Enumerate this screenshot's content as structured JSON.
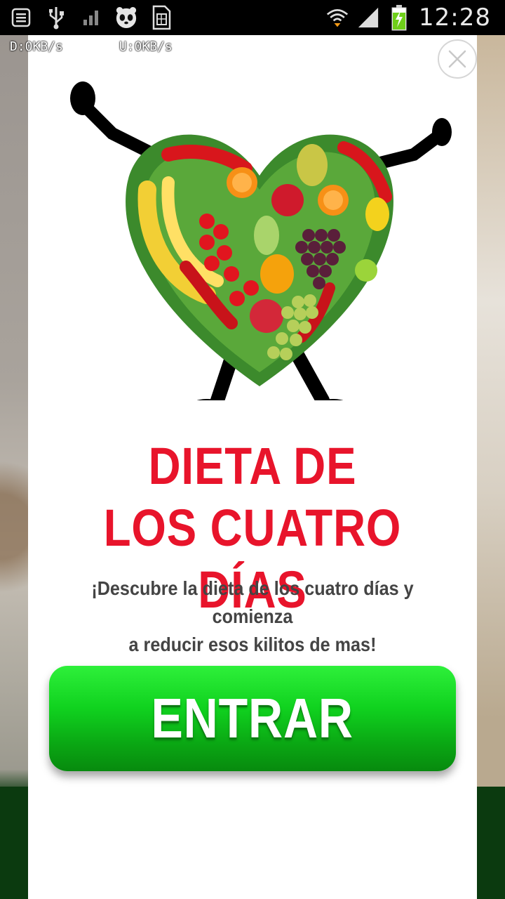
{
  "status_bar": {
    "time": "12:28",
    "icons": [
      "notes-icon",
      "usb-icon",
      "signal-bars-small-icon",
      "panda-icon",
      "sim-card-icon",
      "wifi-icon",
      "cell-signal-icon",
      "battery-charging-icon"
    ]
  },
  "netspeed": {
    "download": "D:0KB/s",
    "upload": "U:0KB/s"
  },
  "dialog": {
    "headline_line1": "DIETA DE",
    "headline_line2": "LOS CUATRO DÍAS",
    "subtitle_line1": "¡Descubre la dieta de los cuatro días y comienza",
    "subtitle_line2": "a reducir esos kilitos de mas!",
    "cta_label": "ENTRAR"
  },
  "colors": {
    "headline": "#e8142b",
    "cta_green": "#10d21f",
    "subtitle": "#444444"
  }
}
